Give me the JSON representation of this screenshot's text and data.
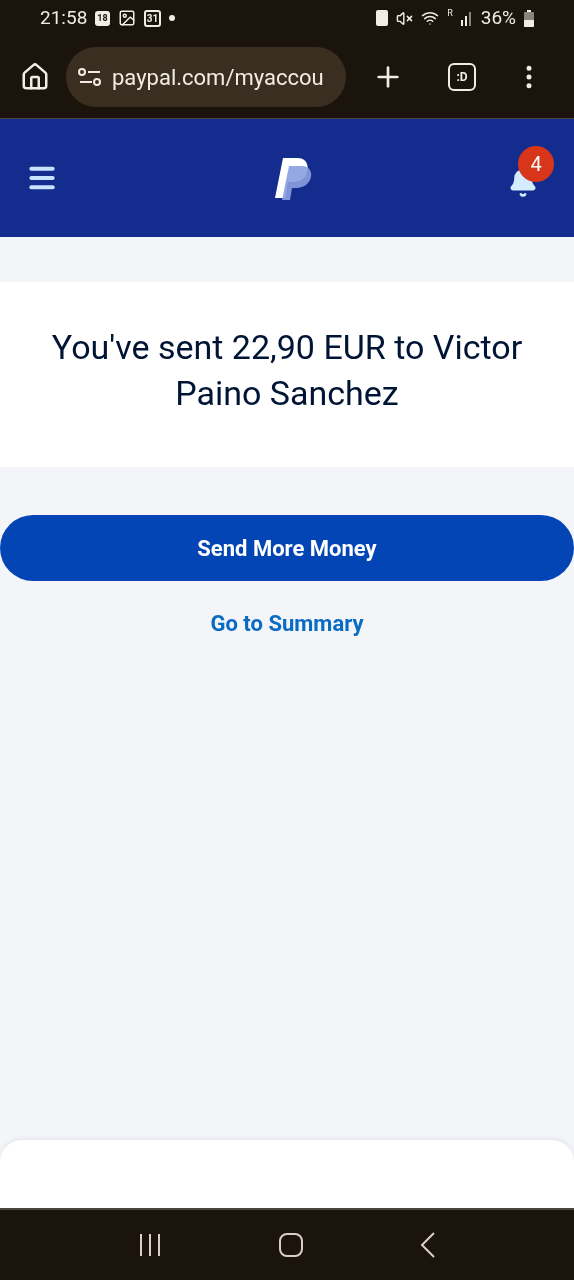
{
  "status_bar": {
    "time": "21:58",
    "calendar_day": "18",
    "date_day": "31",
    "signal_label": "R",
    "battery": "36%"
  },
  "browser": {
    "url": "paypal.com/myaccou",
    "tabs_label": ":D"
  },
  "header": {
    "notification_count": "4"
  },
  "confirmation": {
    "message": "You've sent 22,90 EUR to Victor Paino Sanchez"
  },
  "actions": [
    {
      "kind": "primary",
      "label": "Send More Money"
    },
    {
      "kind": "link",
      "label": "Go to Summary"
    }
  ]
}
